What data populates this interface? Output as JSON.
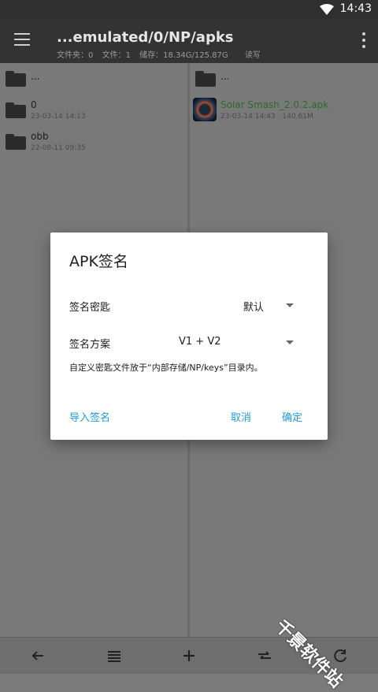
{
  "status_bar": {
    "time": "14:43"
  },
  "toolbar": {
    "title": "...emulated/0/NP/apks",
    "stats": {
      "folders": "文件夹：0",
      "files": "文件：1",
      "storage": "储存：18.34G/125.87G",
      "mode": "读写"
    }
  },
  "left_pane": {
    "parent": {
      "name": "..."
    },
    "items": [
      {
        "name": "0",
        "date": "23-03-14 14:13"
      },
      {
        "name": "obb",
        "date": "22-08-11 09:35"
      }
    ]
  },
  "right_pane": {
    "parent": {
      "name": "..."
    },
    "items": [
      {
        "name": "Solar Smash_2.0.2.apk",
        "date": "23-03-14 14:43",
        "size": "140.61M"
      }
    ]
  },
  "dialog": {
    "title": "APK签名",
    "key_label": "签名密匙",
    "key_value": "默认",
    "scheme_label": "签名方案",
    "scheme_value": "V1 + V2",
    "note": "自定义密匙文件放于“内部存储/NP/keys”目录内。",
    "import_label": "导入签名",
    "cancel_label": "取消",
    "ok_label": "确定",
    "accent_color": "#1e9be0"
  },
  "bottom_bar": {
    "icons": [
      "back-arrow-icon",
      "list-icon",
      "add-icon",
      "swap-icon",
      "refresh-icon"
    ]
  },
  "watermark": {
    "text": "千景软件站"
  }
}
